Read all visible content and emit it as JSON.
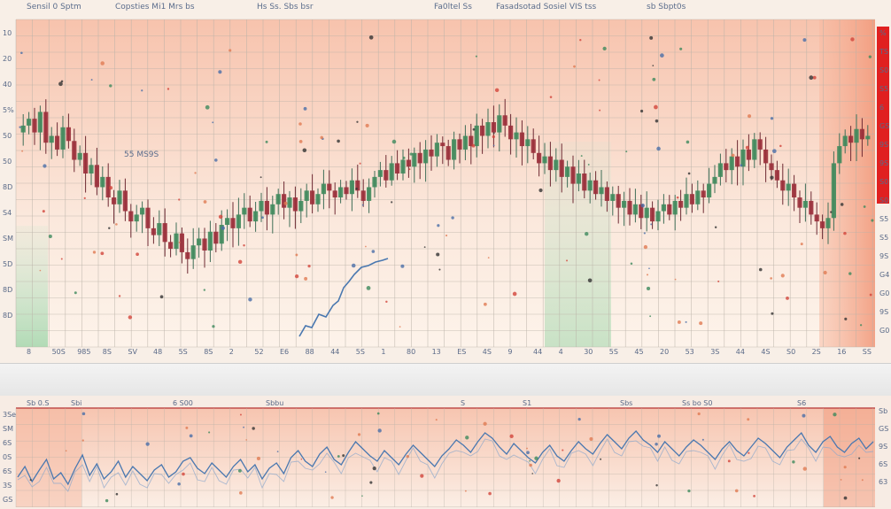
{
  "toolbar": {
    "items": [
      "Sensil  0 Sptm",
      "Copsties Mi1  Mrs  bs",
      "Hs   Ss.  Sbs  bsr",
      "Fa0ltel   Ss",
      "Fasadsotad  Sosiel  VIS  tss",
      "sb   Sbpt0s"
    ]
  },
  "colors": {
    "up": "#3f8a5c",
    "down": "#9a2e38",
    "grid": "#b9b2a8",
    "line": "#4a78b0",
    "bg_warm": "#f6c9b4",
    "bg_green": "#a9d8b0",
    "accent_red": "#e02020"
  },
  "top_panel": {
    "left_axis_labels": [
      "10",
      "20",
      "40",
      "5%",
      "50",
      "50",
      "8D",
      "S4",
      "SM",
      "5D",
      "8D",
      "8D"
    ],
    "right_axis_labels": [
      "%",
      "TS",
      "S0",
      "S5",
      "6",
      "GS",
      "9S",
      "9S",
      "S0",
      "S0",
      "S5",
      "S5",
      "9S",
      "G4",
      "G0",
      "9S",
      "G0"
    ],
    "bottom_axis_labels": [
      "8",
      "50S",
      "985",
      "8S",
      "SV",
      "48",
      "5S",
      "8S",
      "2",
      "52",
      "E6",
      "88",
      "44",
      "5S",
      "1",
      "80",
      "13",
      "ES",
      "4S",
      "9",
      "44",
      "4",
      "30",
      "5S",
      "45",
      "20",
      "53",
      "3S",
      "44",
      "4S",
      "S0",
      "2S",
      "16",
      "SS"
    ],
    "annotation": "55 MS9S"
  },
  "bottom_panel": {
    "header_labels": [
      "Sb  0.S",
      "Sbi",
      "6 S00",
      "Sbbu",
      "S",
      "S1",
      "Sbs",
      "Ss bo  S0",
      "S6"
    ],
    "left_axis_labels": [
      "3Se",
      "SM",
      "6S",
      "0S",
      "6S",
      "3S",
      "GS"
    ],
    "right_axis_labels": [
      "Sb",
      "GS",
      "9S",
      "6S",
      "63"
    ]
  },
  "chart_data": [
    {
      "type": "candlestick",
      "title": "",
      "x": [
        1,
        2,
        3,
        4,
        5,
        6,
        7,
        8,
        9,
        10,
        11,
        12,
        13,
        14,
        15,
        16,
        17,
        18,
        19,
        20,
        21,
        22,
        23,
        24,
        25,
        26,
        27,
        28,
        29,
        30,
        31,
        32,
        33,
        34,
        35,
        36,
        37,
        38,
        39,
        40,
        41,
        42,
        43,
        44,
        45,
        46,
        47,
        48,
        49,
        50,
        51,
        52,
        53,
        54,
        55,
        56,
        57,
        58,
        59,
        60,
        61,
        62,
        63,
        64,
        65,
        66,
        67,
        68,
        69,
        70,
        71,
        72,
        73,
        74,
        75,
        76,
        77,
        78,
        79,
        80,
        81,
        82,
        83,
        84,
        85,
        86,
        87,
        88,
        89,
        90,
        91,
        92,
        93,
        94,
        95,
        96,
        97,
        98,
        99,
        100,
        101,
        102,
        103,
        104,
        105,
        106,
        107,
        108,
        109,
        110,
        111,
        112,
        113,
        114,
        115,
        116,
        117,
        118,
        119,
        120,
        121,
        122,
        123,
        124,
        125,
        126,
        127,
        128,
        129,
        130,
        131,
        132,
        133,
        134,
        135,
        136,
        137,
        138,
        139,
        140,
        141,
        142,
        143,
        144,
        145,
        146,
        147,
        148,
        149,
        150
      ],
      "close": [
        118,
        122,
        114,
        126,
        108,
        112,
        104,
        117,
        109,
        98,
        102,
        90,
        95,
        82,
        88,
        76,
        72,
        80,
        68,
        62,
        66,
        70,
        58,
        54,
        61,
        50,
        46,
        55,
        44,
        40,
        48,
        52,
        45,
        56,
        49,
        60,
        64,
        58,
        66,
        70,
        62,
        68,
        74,
        66,
        72,
        78,
        70,
        76,
        68,
        74,
        80,
        72,
        78,
        84,
        80,
        76,
        82,
        78,
        86,
        80,
        74,
        82,
        88,
        92,
        86,
        96,
        90,
        98,
        94,
        102,
        96,
        104,
        100,
        108,
        106,
        98,
        110,
        104,
        112,
        106,
        118,
        112,
        120,
        114,
        124,
        118,
        110,
        114,
        106,
        110,
        102,
        96,
        100,
        92,
        98,
        88,
        94,
        84,
        90,
        80,
        86,
        78,
        82,
        74,
        78,
        70,
        74,
        66,
        72,
        64,
        70,
        62,
        68,
        72,
        66,
        74,
        70,
        78,
        72,
        80,
        76,
        84,
        88,
        96,
        92,
        100,
        94,
        104,
        98,
        110,
        104,
        96,
        92,
        86,
        80,
        84,
        76,
        70,
        74,
        66,
        62,
        58,
        64,
        96,
        106,
        112,
        108,
        116,
        110,
        112
      ],
      "ylim": [
        0,
        150
      ]
    },
    {
      "type": "line",
      "title": "",
      "x": [
        1,
        2,
        3,
        4,
        5,
        6,
        7,
        8,
        9,
        10,
        11,
        12,
        13,
        14,
        15,
        16,
        17,
        18,
        19,
        20,
        21,
        22,
        23,
        24,
        25,
        26,
        27,
        28,
        29,
        30,
        31,
        32,
        33,
        34,
        35,
        36,
        37,
        38,
        39,
        40,
        41,
        42,
        43,
        44,
        45,
        46,
        47,
        48,
        49,
        50,
        51,
        52,
        53,
        54,
        55,
        56,
        57,
        58,
        59,
        60,
        61,
        62,
        63,
        64,
        65,
        66,
        67,
        68,
        69,
        70,
        71,
        72,
        73,
        74,
        75,
        76,
        77,
        78,
        79,
        80,
        81,
        82,
        83,
        84,
        85,
        86,
        87,
        88,
        89,
        90,
        91,
        92,
        93,
        94,
        95,
        96,
        97,
        98,
        99,
        100,
        101,
        102,
        103,
        104,
        105,
        106,
        107,
        108,
        109,
        110,
        111,
        112,
        113,
        114,
        115,
        116,
        117,
        118,
        119,
        120
      ],
      "values": [
        30,
        42,
        25,
        38,
        50,
        28,
        35,
        22,
        40,
        55,
        32,
        45,
        28,
        36,
        48,
        30,
        42,
        34,
        26,
        38,
        44,
        30,
        36,
        48,
        52,
        40,
        34,
        46,
        38,
        30,
        42,
        50,
        36,
        44,
        28,
        40,
        46,
        34,
        52,
        60,
        48,
        42,
        56,
        64,
        50,
        44,
        58,
        70,
        62,
        54,
        48,
        60,
        52,
        44,
        56,
        66,
        58,
        50,
        42,
        54,
        62,
        72,
        66,
        58,
        70,
        80,
        74,
        64,
        56,
        68,
        60,
        52,
        46,
        58,
        66,
        54,
        48,
        60,
        70,
        62,
        56,
        68,
        78,
        70,
        62,
        74,
        82,
        72,
        66,
        58,
        70,
        62,
        54,
        64,
        72,
        66,
        58,
        50,
        62,
        70,
        60,
        54,
        64,
        74,
        68,
        60,
        52,
        64,
        72,
        80,
        66,
        58,
        70,
        76,
        64,
        58,
        68,
        74,
        62,
        70
      ],
      "ylim": [
        0,
        100
      ]
    }
  ]
}
